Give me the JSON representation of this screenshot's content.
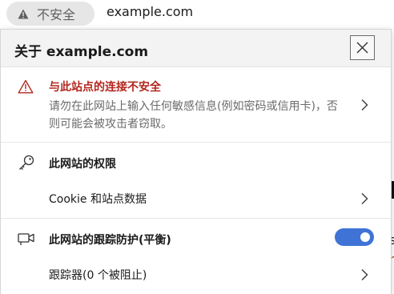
{
  "address_bar": {
    "security_label": "不安全",
    "url": "example.com"
  },
  "panel": {
    "title": "关于 example.com",
    "insecure": {
      "title": "与此站点的连接不安全",
      "description": "请勿在此网站上输入任何敏感信息(例如密码或信用卡)，否则可能会被攻击者窃取。"
    },
    "permissions": {
      "title": "此网站的权限",
      "cookie_label": "Cookie 和站点数据"
    },
    "tracking": {
      "title": "此网站的跟踪防护(平衡)",
      "enabled": true,
      "trackers_label": "跟踪器(0 个被阻止)"
    }
  },
  "background": {
    "fragment_a": "s",
    "fragment_b": "n"
  },
  "colors": {
    "warning_red": "#b3261e",
    "toggle_blue": "#3f74d6",
    "header_bg": "#f3f3f3"
  },
  "icons": [
    "warning-triangle-icon",
    "close-icon",
    "key-icon",
    "camera-icon",
    "chevron-right-icon"
  ]
}
